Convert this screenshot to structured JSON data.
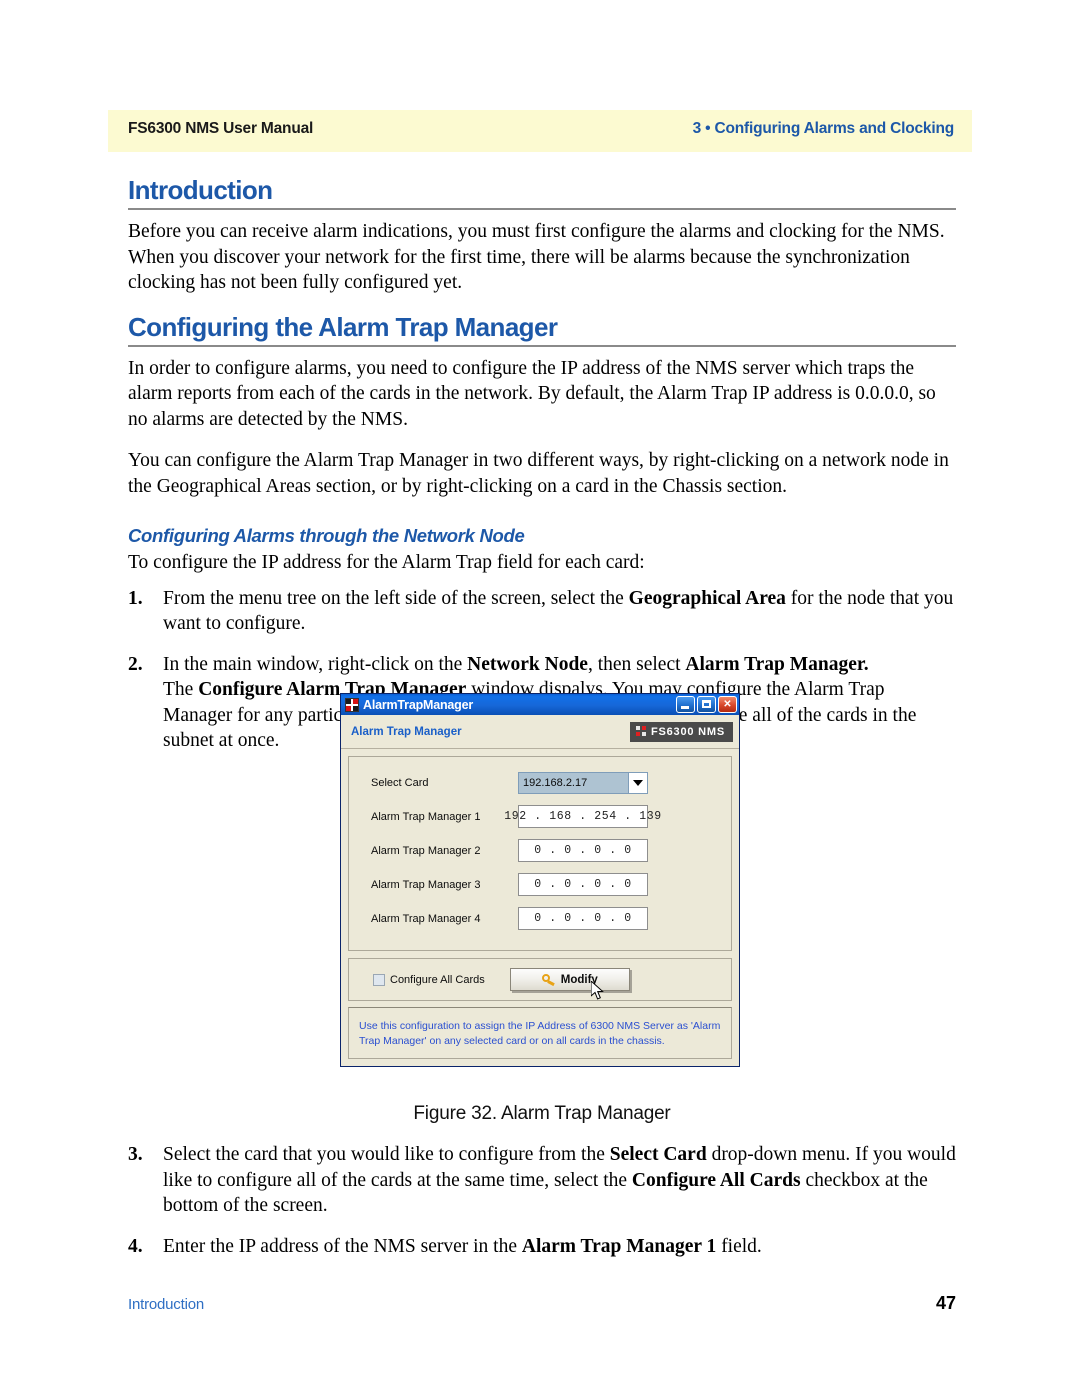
{
  "page": {
    "header_left": "FS6300 NMS User Manual",
    "header_right": "3 • Configuring Alarms and Clocking",
    "footer_left": "Introduction",
    "footer_page_number": "47",
    "accent_blue": "#1d58a8",
    "header_band_color": "#fcfad1"
  },
  "sections": {
    "intro_heading": "Introduction",
    "intro_paragraph": "Before you can receive alarm indications, you must first configure the alarms and clocking for the NMS. When you discover your network for the first time, there will be alarms because the synchronization clocking has not been fully configured yet.",
    "trap_heading": "Configuring the Alarm Trap Manager",
    "trap_paragraph_1": "In order to configure alarms, you need to configure the IP address of the NMS server which traps the alarm reports from each of the cards in the network. By default, the Alarm Trap IP address is 0.0.0.0, so no alarms are detected by the NMS.",
    "trap_paragraph_2": "You can configure the Alarm Trap Manager in two different ways, by right-clicking on a network node in the Geographical Areas section, or by right-clicking on a card in the Chassis section.",
    "network_node_subheading": "Configuring Alarms through the Network Node",
    "network_node_intro": "To configure the IP address for the Alarm Trap field for each card:"
  },
  "steps": {
    "step1_number": "1.",
    "step1_a": "From the menu tree on the left side of the screen, select the ",
    "step1_bold": "Geographical Area",
    "step1_b": " for the node that you want to configure.",
    "step2_number": "2.",
    "step2_a": "In the main window, right-click on the ",
    "step2_bold1": "Network Node",
    "step2_b": ", then select ",
    "step2_bold2": "Alarm Trap Manager.",
    "step2_c": "The ",
    "step2_bold3": "Configure Alarm Trap Manager",
    "step2_d": " window dispalys. You may configure the Alarm Trap Manager for any particular card in the chassis’ subnet or you can configure all of the cards in the subnet at once.",
    "step3_number": "3.",
    "step3_a": "Select the card that you would like to configure from the ",
    "step3_bold1": "Select Card",
    "step3_b": " drop-down menu. If you would like to configure all of the cards at the same time, select the ",
    "step3_bold2": "Configure All Cards",
    "step3_c": " checkbox at the bottom of the screen.",
    "step4_number": "4.",
    "step4_a": "Enter the IP address of the NMS server in the ",
    "step4_bold1": "Alarm Trap Manager 1",
    "step4_b": " field."
  },
  "figure": {
    "caption": "Figure 32. Alarm Trap Manager"
  },
  "dialog": {
    "window_title": "AlarmTrapManager",
    "banner_title": "Alarm Trap Manager",
    "brand_badge": "FS6300 NMS",
    "minimize_label": "Minimize",
    "maximize_label": "Maximize",
    "close_label": "✕",
    "fields": [
      {
        "label": "Select Card",
        "value": "192.168.2.17",
        "type": "combo"
      },
      {
        "label": "Alarm Trap Manager 1",
        "value": "192 . 168 . 254 . 139",
        "type": "ip"
      },
      {
        "label": "Alarm Trap Manager 2",
        "value": "0  .  0  .  0  .  0",
        "type": "ip"
      },
      {
        "label": "Alarm Trap Manager 3",
        "value": "0  .  0  .  0  .  0",
        "type": "ip"
      },
      {
        "label": "Alarm Trap Manager 4",
        "value": "0  .  0  .  0  .  0",
        "type": "ip"
      }
    ],
    "configure_all_label": "Configure All Cards",
    "modify_button_label": "Modify",
    "status_line_1": "Use this configuration to assign the IP Address of 6300 NMS Server as 'Alarm",
    "status_line_2": "Trap Manager' on any selected card or on all cards in the chassis.",
    "titlebar_color": "#1667d8",
    "face_color": "#ece9d8",
    "status_text_color": "#2a4fd0"
  }
}
